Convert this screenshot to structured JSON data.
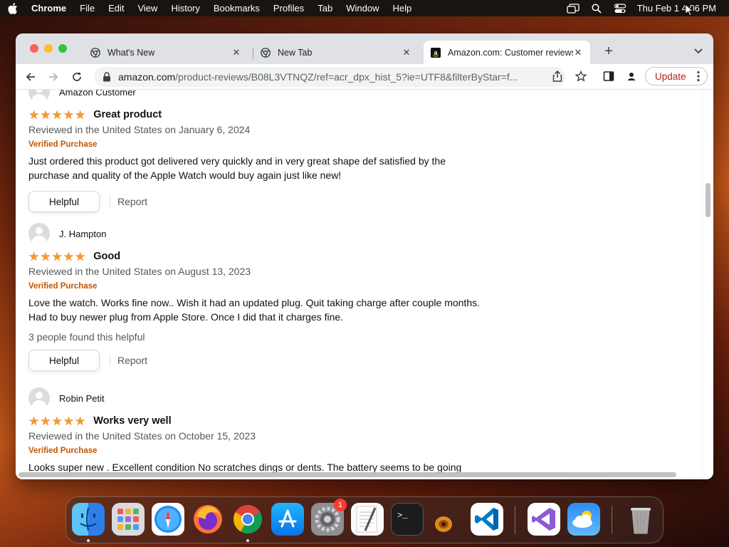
{
  "menubar": {
    "app_name": "Chrome",
    "items": [
      "File",
      "Edit",
      "View",
      "History",
      "Bookmarks",
      "Profiles",
      "Tab",
      "Window",
      "Help"
    ],
    "clock": "Thu Feb 1  4:06 PM"
  },
  "browser": {
    "tabs": [
      {
        "title": "What's New",
        "icon": "chrome-icon"
      },
      {
        "title": "New Tab",
        "icon": "chrome-icon"
      },
      {
        "title": "Amazon.com: Customer reviews",
        "icon": "amazon-icon",
        "active": true
      }
    ],
    "url_host": "amazon.com",
    "url_path": "/product-reviews/B08L3VTNQZ/ref=acr_dpx_hist_5?ie=UTF8&filterByStar=f...",
    "update_label": "Update"
  },
  "reviews": [
    {
      "reviewer": "Amazon Customer",
      "rating": 5,
      "title": "Great product",
      "date": "Reviewed in the United States on January 6, 2024",
      "verified": "Verified Purchase",
      "body_lines": [
        "Just ordered this product got delivered very quickly and in very great shape def satisfied by the",
        "purchase and quality of the Apple Watch would buy again just like new!"
      ],
      "helpful_label": "Helpful",
      "report_label": "Report"
    },
    {
      "reviewer": "J. Hampton",
      "rating": 5,
      "title": "Good",
      "date": "Reviewed in the United States on August 13, 2023",
      "verified": "Verified Purchase",
      "body_lines": [
        "Love the watch. Works fine now.. Wish it had an updated plug. Quit taking charge after couple months.",
        "Had to buy newer plug from Apple Store. Once I did that it charges fine."
      ],
      "helpful_count": "3 people found this helpful",
      "helpful_label": "Helpful",
      "report_label": "Report"
    },
    {
      "reviewer": "Robin Petit",
      "rating": 5,
      "title": "Works very well",
      "date": "Reviewed in the United States on October 15, 2023",
      "verified": "Verified Purchase",
      "body_lines": [
        "Looks super new . Excellent condition No scratches dings or dents. The battery seems to be going"
      ]
    }
  ],
  "dock": {
    "apps": [
      "finder",
      "launchpad",
      "safari",
      "firefox",
      "chrome",
      "app-store",
      "system-settings",
      "textedit",
      "terminal",
      "garageband",
      "vscode",
      "visual-studio",
      "weather",
      "trash"
    ],
    "system_settings_badge": "1"
  }
}
